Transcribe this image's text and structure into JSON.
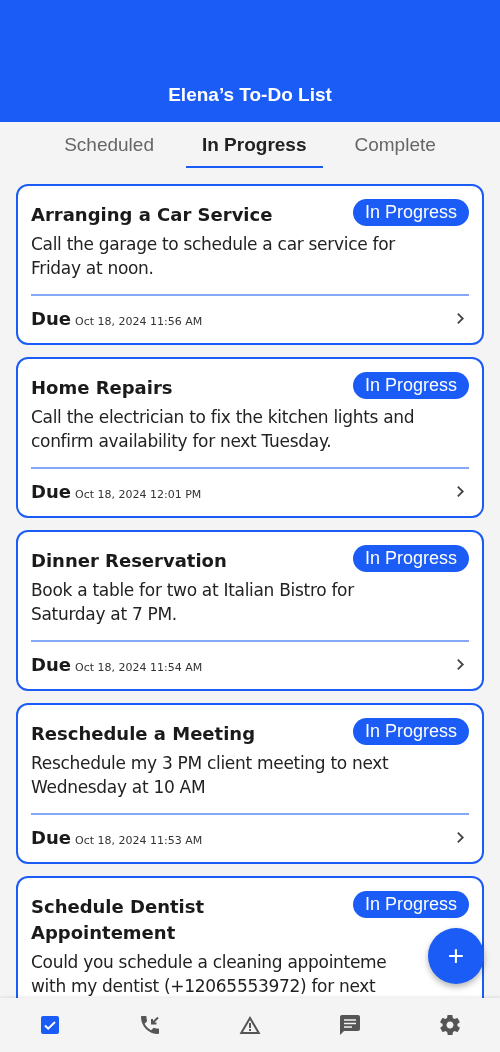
{
  "header": {
    "title": "Elena’s To-Do List"
  },
  "tabs": [
    {
      "label": "Scheduled",
      "selected": false
    },
    {
      "label": "In Progress",
      "selected": true
    },
    {
      "label": "Complete",
      "selected": false
    }
  ],
  "tasks": [
    {
      "title": [
        "Arranging a Car Service"
      ],
      "status": "In Progress",
      "description": [
        "Call the garage to schedule a car service for",
        "Friday at noon."
      ],
      "due_label": "Due",
      "due_date": "Oct 18, 2024 11:56 AM"
    },
    {
      "title": [
        "Home Repairs"
      ],
      "status": "In Progress",
      "description": [
        "Call the electrician to fix the kitchen lights and",
        "confirm availability for next Tuesday."
      ],
      "due_label": "Due",
      "due_date": "Oct 18, 2024 12:01 PM"
    },
    {
      "title": [
        "Dinner Reservation"
      ],
      "status": "In Progress",
      "description": [
        "Book a table for two at Italian Bistro for",
        "Saturday at 7 PM."
      ],
      "due_label": "Due",
      "due_date": "Oct 18, 2024 11:54 AM"
    },
    {
      "title": [
        "Reschedule a Meeting"
      ],
      "status": "In Progress",
      "description": [
        "Reschedule my 3 PM client meeting to next",
        "Wednesday at 10 AM"
      ],
      "due_label": "Due",
      "due_date": "Oct 18, 2024 11:53 AM"
    },
    {
      "title": [
        "Schedule Dentist",
        "Appointement"
      ],
      "status": "In Progress",
      "description": [
        "Could you schedule a cleaning appointeme",
        "with my dentist (+12065553972) for next"
      ]
    }
  ],
  "fab": {
    "label": "+"
  },
  "nav": [
    {
      "kind": "tasks",
      "selected": true
    },
    {
      "kind": "calls",
      "selected": false
    },
    {
      "kind": "alerts",
      "selected": false
    },
    {
      "kind": "messages",
      "selected": false
    },
    {
      "kind": "settings",
      "selected": false
    }
  ]
}
